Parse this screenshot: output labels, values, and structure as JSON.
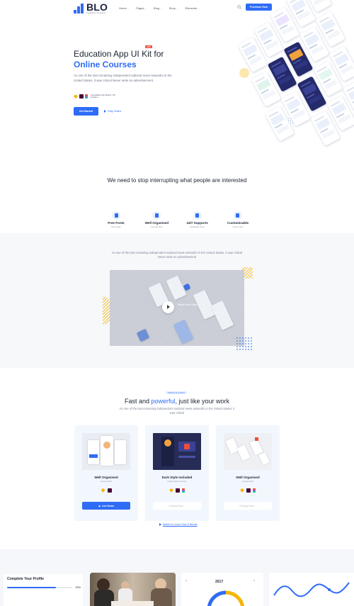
{
  "brand": {
    "name": "BLO",
    "tagline": "Freelance Company"
  },
  "nav": {
    "items": [
      {
        "label": "Home"
      },
      {
        "label": "Pages"
      },
      {
        "label": "Blog"
      },
      {
        "label": "Shop"
      },
      {
        "label": "Elements"
      }
    ],
    "search_icon": "search-icon",
    "purchase_label": "Purchase Now"
  },
  "hero": {
    "title_line1": "Education App UI Kit for",
    "title_line2": "Online Courses",
    "new_badge": "NEW",
    "description": "As one of the last remaining independent national news networks in the United States, it was critical Never write an advertisement",
    "compat_text": "Compatible with Sketch, XD & Figma",
    "get_started": "Get Started",
    "play_video": "Play Video"
  },
  "intro": {
    "title": "We need to stop interrupting what people are interested"
  },
  "features": [
    {
      "title": "Free Fonts",
      "sub": "By Google"
    },
    {
      "title": "Well Organised",
      "sub": "Layered Files"
    },
    {
      "title": "24/7 Supports",
      "sub": "Dedicated Team"
    },
    {
      "title": "Customisable",
      "sub": "Vector Files"
    }
  ],
  "video_section": {
    "description": "As one of the last remaining independent national news networks in the United States, it was critical Never write an advertisement",
    "watch_text": "Watch Intro Video"
  },
  "showcase": {
    "badge": "Features at a Glance",
    "title_pre": "Fast and ",
    "title_hl": "powerful",
    "title_post": ", just like your work",
    "description": "As one of the last remaining independent national news networks in the United States, it was critical",
    "cards": [
      {
        "title": "Well Organised",
        "sub": "Layered Files",
        "button": "Live Demo"
      },
      {
        "title": "Dark Style Included",
        "sub": "Light & Dark Versions",
        "button": "Coming Soon..."
      },
      {
        "title": "Well Organised",
        "sub": "Layered Files",
        "button": "Coming Soon..."
      }
    ],
    "watch_learn": "Watch & Learn How It Works"
  },
  "bottom": {
    "profile_title": "Complete Your Profile",
    "profile_progress": 75,
    "profile_progress_label": "75%",
    "year": "2017"
  },
  "colors": {
    "accent": "#2f6cf6",
    "badge_red": "#ee4d3b",
    "sketch_yellow": "#f7b500",
    "xd_dark": "#470137",
    "figma_red": "#f24e1e"
  }
}
